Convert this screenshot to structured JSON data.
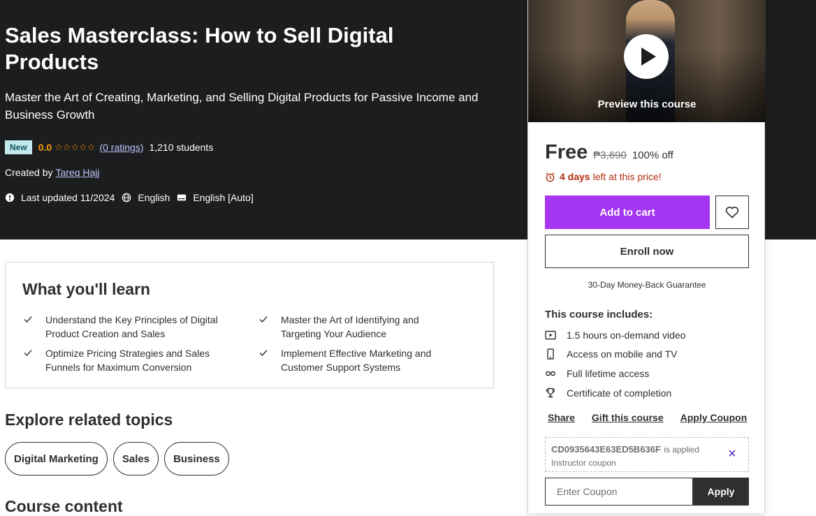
{
  "course": {
    "title": "Sales Masterclass: How to Sell Digital Products",
    "subtitle": "Master the Art of Creating, Marketing, and Selling Digital Products for Passive Income and Business Growth",
    "badge": "New",
    "rating": "0.0",
    "stars": "☆☆☆☆☆",
    "ratings_count": "(0 ratings)",
    "students": "1,210 students",
    "created_by_label": "Created by",
    "instructor": "Tareq Hajj",
    "last_updated": "Last updated 11/2024",
    "language": "English",
    "captions": "English [Auto]"
  },
  "sidebar": {
    "preview_label": "Preview this course",
    "price": "Free",
    "original_price": "₱3,690",
    "discount": "100% off",
    "timer_days": "4 days",
    "timer_text": "left at this price!",
    "add_to_cart": "Add to cart",
    "enroll_now": "Enroll now",
    "guarantee": "30-Day Money-Back Guarantee",
    "includes_title": "This course includes:",
    "includes": [
      {
        "icon": "video-icon",
        "text": "1.5 hours on-demand video"
      },
      {
        "icon": "mobile-icon",
        "text": "Access on mobile and TV"
      },
      {
        "icon": "infinity-icon",
        "text": "Full lifetime access"
      },
      {
        "icon": "trophy-icon",
        "text": "Certificate of completion"
      }
    ],
    "links": [
      "Share",
      "Gift this course",
      "Apply Coupon"
    ],
    "coupon_code": "CD0935643E63ED5B636F",
    "coupon_applied": "is applied",
    "coupon_note": "Instructor coupon",
    "coupon_placeholder": "Enter Coupon",
    "apply_label": "Apply"
  },
  "learn": {
    "title": "What you'll learn",
    "items": [
      "Understand the Key Principles of Digital Product Creation and Sales",
      "Master the Art of Identifying and Targeting Your Audience",
      "Optimize Pricing Strategies and Sales Funnels for Maximum Conversion",
      "Implement Effective Marketing and Customer Support Systems"
    ]
  },
  "related": {
    "title": "Explore related topics",
    "topics": [
      "Digital Marketing",
      "Sales",
      "Business"
    ]
  },
  "content": {
    "title": "Course content"
  },
  "colors": {
    "hero_bg": "#1c1d1f",
    "primary": "#a435f0",
    "rating": "#f69c08",
    "timer": "#b32d0f",
    "link_light": "#c0c4fc"
  }
}
